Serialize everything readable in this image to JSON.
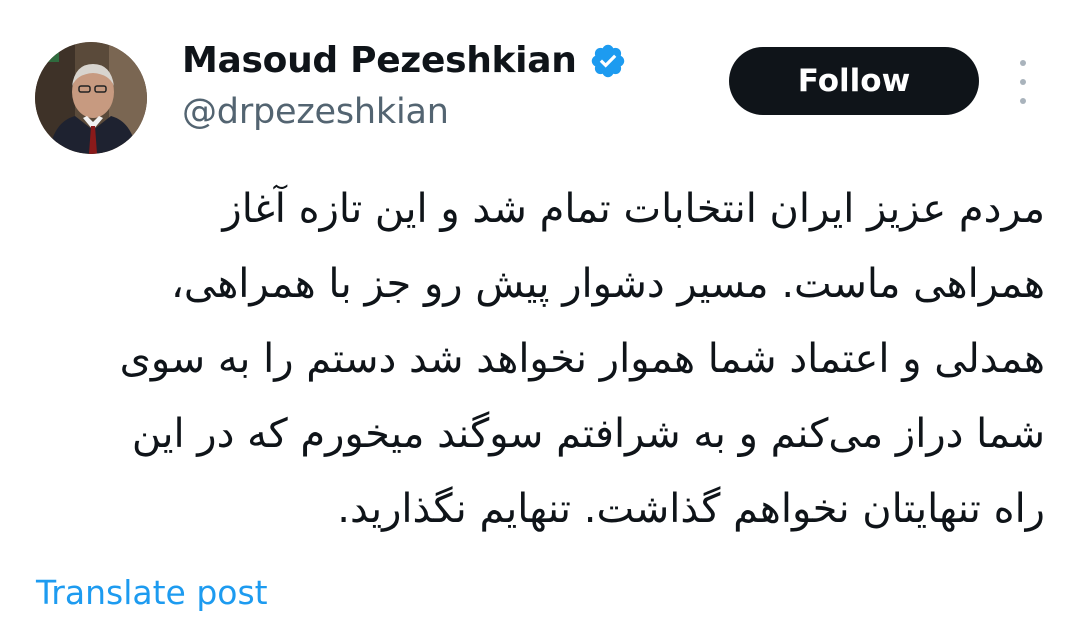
{
  "author": {
    "display_name": "Masoud Pezeshkian",
    "handle": "@drpezeshkian",
    "verified": true,
    "avatar_icon": "profile-photo"
  },
  "actions": {
    "follow_label": "Follow",
    "more_icon": "more-vertical-icon"
  },
  "post": {
    "direction": "rtl",
    "lines": [
      "مردم عزیز ایران انتخابات تمام شد و این تازه آغاز",
      "همراهی ماست. مسیر دشوار پیش رو جز با همراهی،",
      "همدلی و اعتماد شما هموار نخواهد شد دستم را به سوی",
      "شما دراز می‌کنم و به شرافتم سوگند میخورم که در این",
      "راه تنهایتان نخواهم گذاشت. تنهایم نگذارید."
    ]
  },
  "footer": {
    "translate_label": "Translate post"
  },
  "colors": {
    "text_primary": "#0f1419",
    "text_secondary": "#536471",
    "link": "#1d9bf0",
    "verified_badge": "#1d9bf0",
    "follow_bg": "#0f1419",
    "follow_text": "#ffffff"
  }
}
